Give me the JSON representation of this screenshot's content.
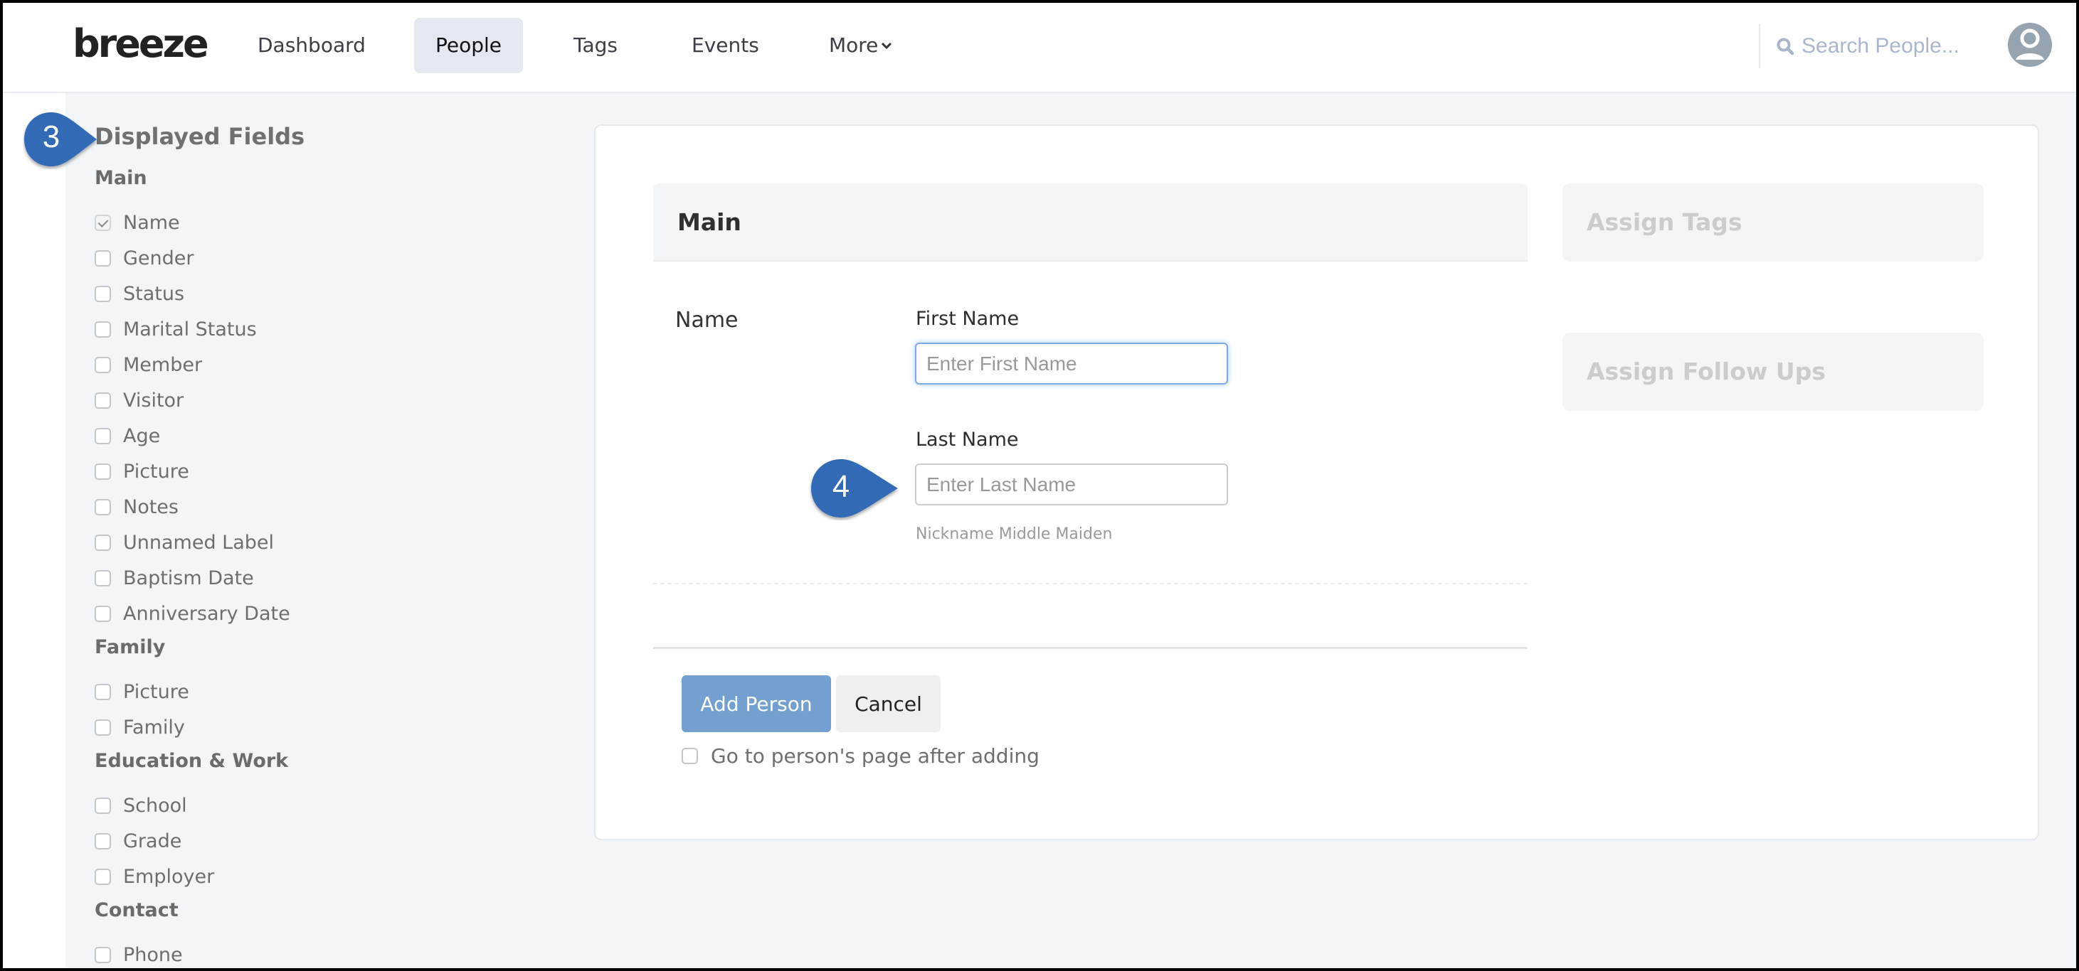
{
  "header": {
    "logo": "breeze",
    "nav": [
      {
        "label": "Dashboard",
        "active": false
      },
      {
        "label": "People",
        "active": true
      },
      {
        "label": "Tags",
        "active": false
      },
      {
        "label": "Events",
        "active": false
      },
      {
        "label": "More",
        "active": false,
        "has_dropdown": true
      }
    ],
    "search_placeholder": "Search People...",
    "icons": {
      "search": "search-icon",
      "avatar": "user-avatar-icon",
      "more": "chevron-down-icon"
    }
  },
  "sidebar": {
    "title": "Displayed Fields",
    "groups": [
      {
        "heading": "Main",
        "items": [
          {
            "label": "Name",
            "checked": true
          },
          {
            "label": "Gender",
            "checked": false
          },
          {
            "label": "Status",
            "checked": false
          },
          {
            "label": "Marital Status",
            "checked": false
          },
          {
            "label": "Member",
            "checked": false
          },
          {
            "label": "Visitor",
            "checked": false
          },
          {
            "label": "Age",
            "checked": false
          },
          {
            "label": "Picture",
            "checked": false
          },
          {
            "label": "Notes",
            "checked": false
          },
          {
            "label": "Unnamed Label",
            "checked": false
          },
          {
            "label": "Baptism Date",
            "checked": false
          },
          {
            "label": "Anniversary Date",
            "checked": false
          }
        ]
      },
      {
        "heading": "Family",
        "items": [
          {
            "label": "Picture",
            "checked": false
          },
          {
            "label": "Family",
            "checked": false
          }
        ]
      },
      {
        "heading": "Education & Work",
        "items": [
          {
            "label": "School",
            "checked": false
          },
          {
            "label": "Grade",
            "checked": false
          },
          {
            "label": "Employer",
            "checked": false
          }
        ]
      },
      {
        "heading": "Contact",
        "items": [
          {
            "label": "Phone",
            "checked": false
          }
        ]
      }
    ]
  },
  "form": {
    "section_title": "Main",
    "field_label": "Name",
    "first_name": {
      "label": "First Name",
      "placeholder": "Enter First Name",
      "value": ""
    },
    "last_name": {
      "label": "Last Name",
      "placeholder": "Enter Last Name",
      "value": ""
    },
    "hint": "Nickname Middle Maiden",
    "add_button": "Add Person",
    "cancel_button": "Cancel",
    "go_to_page_label": "Go to person's page after adding",
    "go_to_page_checked": false
  },
  "side_cards": [
    {
      "title": "Assign Tags"
    },
    {
      "title": "Assign Follow Ups"
    }
  ],
  "callouts": [
    {
      "number": "3",
      "target": "Displayed Fields"
    },
    {
      "number": "4",
      "target": "Last Name input"
    }
  ],
  "colors": {
    "accent": "#73a0cf",
    "callout": "#316bb5",
    "page_bg": "#f3f6f9"
  }
}
